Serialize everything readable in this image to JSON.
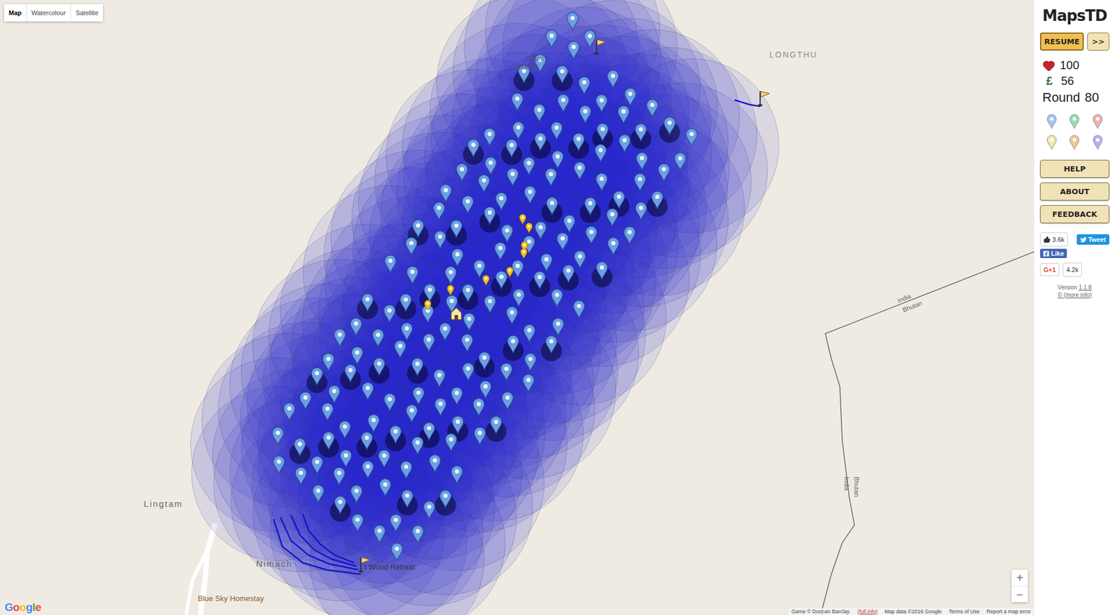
{
  "map_type_control": [
    {
      "label": "Map",
      "selected": true
    },
    {
      "label": "Watercolour",
      "selected": false
    },
    {
      "label": "Satellite",
      "selected": false
    }
  ],
  "map": {
    "place_labels": [
      {
        "text": "LONGTHU",
        "kind": "region"
      },
      {
        "text": "Lingtam",
        "kind": "town"
      },
      {
        "text": "Nimach",
        "kind": "town"
      },
      {
        "text": "Thami",
        "kind": "village"
      },
      {
        "text": "Dhunkel",
        "kind": "village"
      },
      {
        "text": "t Wood Retreat",
        "kind": "poi"
      },
      {
        "text": "Blue Sky Homestay",
        "kind": "lodging"
      }
    ],
    "border_labels": [
      {
        "text": "India",
        "kind": "diagonal"
      },
      {
        "text": "Bhutan",
        "kind": "diagonal"
      },
      {
        "text": "India",
        "kind": "vertical"
      },
      {
        "text": "Bhutan",
        "kind": "vertical"
      }
    ],
    "towers": {
      "count": 165,
      "color": "#6b9fe6"
    },
    "enemies": {
      "count": 8,
      "color": "#f5c21b"
    },
    "flags": {
      "count": 3
    },
    "home": {
      "shown": true
    },
    "zoom": [
      "+",
      "−"
    ],
    "google_logo": "Google",
    "footer": [
      "Game © Duncan Barclay.",
      "(full info)",
      "Map data ©2016 Google",
      "Terms of Use",
      "Report a map error"
    ]
  },
  "sidebar": {
    "logo": "MapsTD",
    "resume_button": "RESUME",
    "fast_button": ">>",
    "lives": "100",
    "money_symbol": "£",
    "money": "56",
    "round_label": "Round",
    "round": "80",
    "tower_palette": [
      {
        "color": "#a9c3ee",
        "selected": false
      },
      {
        "color": "#93deb0",
        "selected": false
      },
      {
        "color": "#f4b0ac",
        "selected": false
      },
      {
        "color": "#efe9a6",
        "selected": false
      },
      {
        "color": "#f3c88f",
        "selected": false
      },
      {
        "color": "#b9b2ef",
        "selected": false
      }
    ],
    "menu": [
      "HELP",
      "ABOUT",
      "FEEDBACK"
    ],
    "social": {
      "like_count": "3.6k",
      "tweet": "Tweet",
      "fb_like": "Like",
      "gplus": "G+1",
      "gplus_count": "4.2k"
    },
    "version_label": "Version",
    "version": "1.1.8",
    "copyright": "© (more info)"
  }
}
